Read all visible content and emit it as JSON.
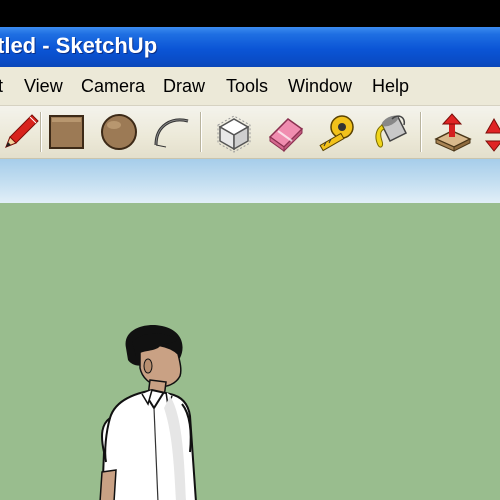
{
  "window": {
    "title": "tled - SketchUp"
  },
  "menubar": {
    "items": [
      {
        "label": "t"
      },
      {
        "label": "View"
      },
      {
        "label": "Camera"
      },
      {
        "label": "Draw"
      },
      {
        "label": "Tools"
      },
      {
        "label": "Window"
      },
      {
        "label": "Help"
      }
    ]
  },
  "toolbar": {
    "tools": [
      {
        "icon": "pencil-icon",
        "name": "Line"
      },
      {
        "icon": "rectangle-icon",
        "name": "Rectangle"
      },
      {
        "icon": "circle-icon",
        "name": "Circle"
      },
      {
        "icon": "arc-icon",
        "name": "Arc"
      },
      {
        "icon": "make-component-icon",
        "name": "Make Component"
      },
      {
        "icon": "eraser-icon",
        "name": "Eraser"
      },
      {
        "icon": "tape-measure-icon",
        "name": "Tape Measure"
      },
      {
        "icon": "paint-bucket-icon",
        "name": "Paint Bucket"
      },
      {
        "icon": "push-pull-icon",
        "name": "Push/Pull"
      },
      {
        "icon": "move-icon",
        "name": "Move"
      }
    ]
  },
  "colors": {
    "titlebar": "#0b55d6",
    "menubar": "#ece9d8",
    "sky": "#c5dff1",
    "ground": "#99bd8e"
  }
}
